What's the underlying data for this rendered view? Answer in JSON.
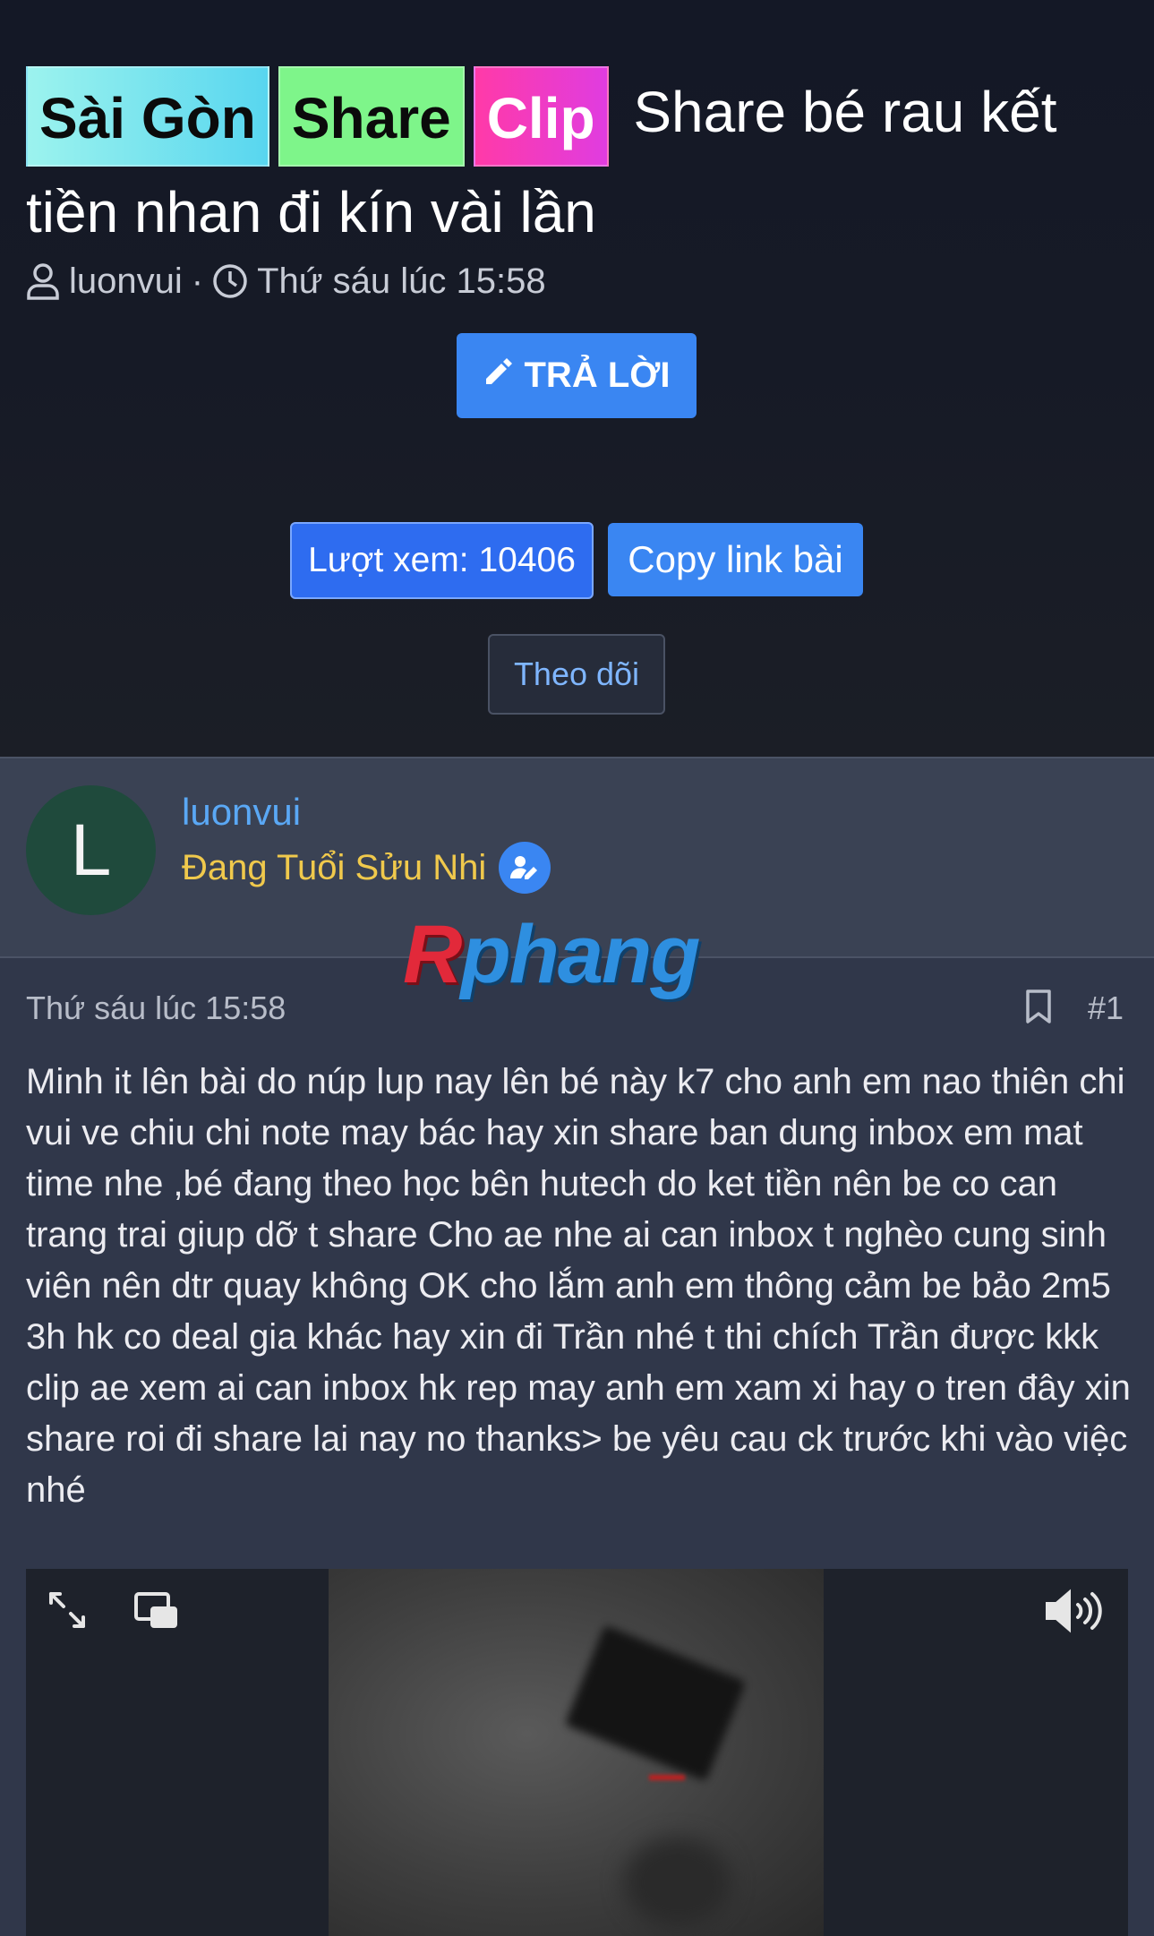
{
  "thread": {
    "tags": [
      "Sài Gòn",
      "Share",
      "Clip"
    ],
    "title": "Share bé rau kết tiền nhan đi kín vài lần",
    "author": "luonvui",
    "separator": "·",
    "time": "Thứ sáu lúc 15:58"
  },
  "actions": {
    "reply_label": "TRẢ LỜI",
    "views_label": "Lượt xem: 10406",
    "copy_label": "Copy link bài",
    "follow_label": "Theo dõi"
  },
  "user": {
    "avatar_letter": "L",
    "name": "luonvui",
    "title": "Đang Tuổi Sửu Nhi"
  },
  "watermark": {
    "first": "R",
    "rest": "phang"
  },
  "post": {
    "date": "Thứ sáu lúc 15:58",
    "number": "#1",
    "body": "Minh it lên bài do núp lup nay lên bé này k7 cho anh em nao thiên chi vui ve chiu chi note may bác hay xin share ban dung inbox em mat time nhe ,bé đang theo học bên hutech do ket tiền nên be co can trang trai giup dỡ t share Cho ae nhe ai can inbox t nghèo cung sinh viên nên dtr quay không OK cho lắm anh em thông cảm be bảo 2m5 3h hk co deal gia khác hay xin đi Trần nhé t thi chích Trần được kkk clip ae xem ai can inbox hk rep may anh em xam xi hay o tren đây xin share roi đi share lai nay no thanks> be yêu cau ck trước khi vào việc nhé"
  },
  "icons": {
    "author": "user-icon",
    "time": "clock-icon",
    "reply": "pencil-icon",
    "verify": "user-edit-icon",
    "bookmark": "bookmark-icon",
    "fullscreen": "expand-icon",
    "pip": "picture-in-picture-icon",
    "volume": "volume-icon"
  },
  "colors": {
    "accent": "#3a86f2",
    "username": "#5aa8f5",
    "user_title": "#f0c94c",
    "tag_share": "#7ef58a",
    "tag_clip": "#ff3aa8"
  }
}
